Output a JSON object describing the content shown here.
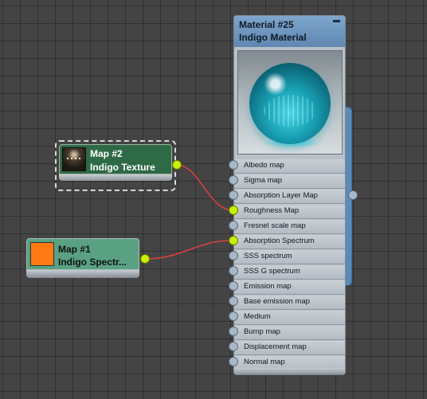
{
  "material_node": {
    "title_line1": "Material #25",
    "title_line2": "Indigo Material",
    "slots": [
      {
        "label": "Albedo map",
        "connected": false
      },
      {
        "label": "Sigma map",
        "connected": false
      },
      {
        "label": "Absorption Layer Map",
        "connected": false
      },
      {
        "label": "Roughness Map",
        "connected": true
      },
      {
        "label": "Fresnel scale map",
        "connected": false
      },
      {
        "label": "Absorption Spectrum",
        "connected": true
      },
      {
        "label": "SSS spectrum",
        "connected": false
      },
      {
        "label": "SSS G spectrum",
        "connected": false
      },
      {
        "label": "Emission map",
        "connected": false
      },
      {
        "label": "Base emission map",
        "connected": false
      },
      {
        "label": "Medium",
        "connected": false
      },
      {
        "label": "Bump map",
        "connected": false
      },
      {
        "label": "Displacement map",
        "connected": false
      },
      {
        "label": "Normal map",
        "connected": false
      }
    ]
  },
  "map2_node": {
    "title_line1": "Map #2",
    "title_line2": "Indigo Texture",
    "selected": true
  },
  "map1_node": {
    "title_line1": "Map #1",
    "title_line2": "Indigo  Spectr...",
    "swatch_color": "#ff7a12"
  },
  "colors": {
    "wire": "#e04040",
    "socket_active": "#c8f000",
    "material_header": "#6f97c0",
    "map2_body": "#2e6a45",
    "map1_body": "#5aa184"
  }
}
